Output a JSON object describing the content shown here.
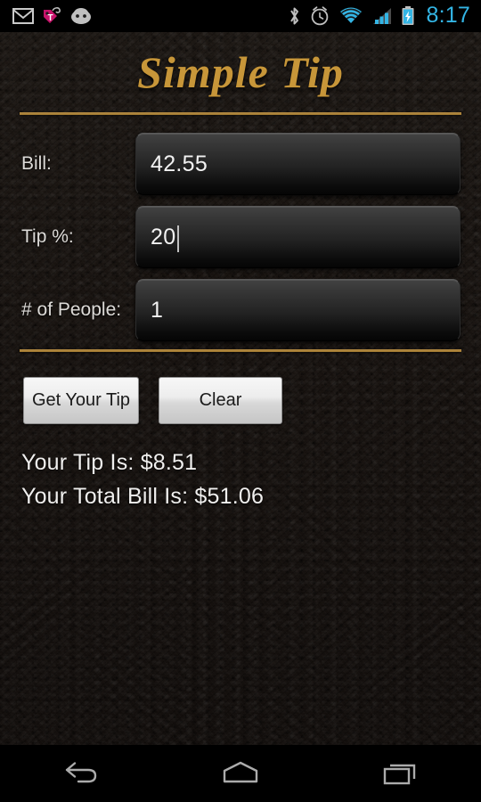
{
  "status_bar": {
    "icons_left": [
      "gmail-icon",
      "tmobile-tag-icon",
      "cyanogenmod-android-icon"
    ],
    "icons_right": [
      "bluetooth-icon",
      "alarm-clock-icon",
      "wifi-icon",
      "cell-signal-icon",
      "battery-charging-icon"
    ],
    "clock": "8:17",
    "clock_color": "#33B5E5"
  },
  "app": {
    "title": "Simple Tip",
    "title_color": "#C79639",
    "divider_color": "#B08440",
    "background_color": "#181310"
  },
  "form": {
    "fields": [
      {
        "label": "Bill:",
        "value": "42.55",
        "focused": false
      },
      {
        "label": "Tip %:",
        "value": "20",
        "focused": true
      },
      {
        "label": "# of People:",
        "value": "1",
        "focused": false
      }
    ]
  },
  "buttons": {
    "get_tip_label": "Get Your Tip",
    "clear_label": "Clear"
  },
  "results": {
    "tip_line": "Your Tip Is: $8.51",
    "total_line": "Your Total Bill Is: $51.06"
  },
  "nav_bar": {
    "back_label": "Back",
    "home_label": "Home",
    "recents_label": "Recent apps"
  }
}
